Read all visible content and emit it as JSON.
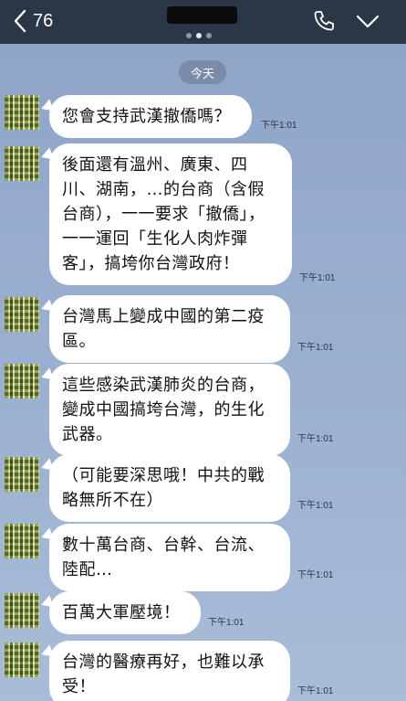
{
  "header": {
    "unread_count": "76",
    "pager_dots": 3,
    "pager_active": 1
  },
  "date_separator": "今天",
  "messages": [
    {
      "text": "您會支持武漢撤僑嗎？",
      "time": "下午1:01"
    },
    {
      "text": "後面還有溫州、廣東、四川、湖南，…的台商（含假台商），一一要求「撤僑」，一一運回「生化人肉炸彈客」，搞垮你台灣政府！",
      "time": "下午1:01"
    },
    {
      "text": "台灣馬上變成中國的第二疫區。",
      "time": "下午1:01"
    },
    {
      "text": "這些感染武漢肺炎的台商，變成中國搞垮台灣，的生化武器。",
      "time": "下午1:01"
    },
    {
      "text": "（可能要深思哦！中共的戰略無所不在）",
      "time": "下午1:01"
    },
    {
      "text": "數十萬台商、台幹、台流、陸配…",
      "time": "下午1:01"
    },
    {
      "text": "百萬大軍壓境！",
      "time": "下午1:01"
    },
    {
      "text": "台灣的醫療再好，也難以承受！",
      "time": "下午1:01"
    }
  ]
}
